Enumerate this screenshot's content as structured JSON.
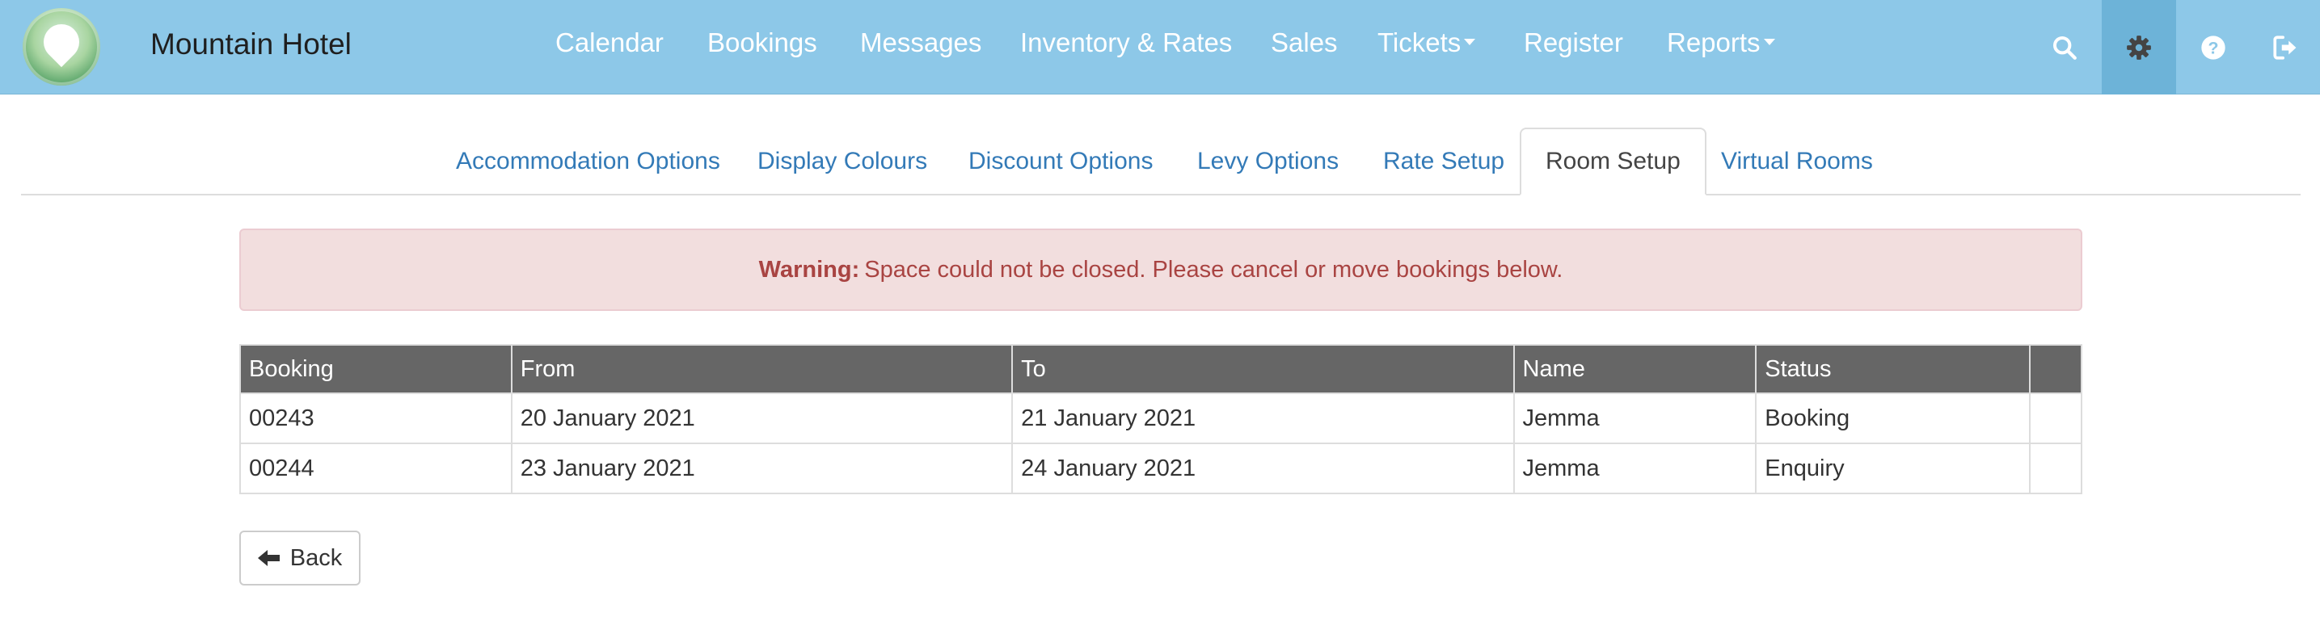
{
  "app": {
    "brand": "Mountain Hotel"
  },
  "nav": {
    "items": [
      {
        "label": "Calendar"
      },
      {
        "label": "Bookings"
      },
      {
        "label": "Messages"
      },
      {
        "label": "Inventory & Rates"
      },
      {
        "label": "Sales"
      },
      {
        "label": "Tickets",
        "dropdown": true
      },
      {
        "label": "Register"
      },
      {
        "label": "Reports",
        "dropdown": true
      }
    ],
    "icons": [
      "search-icon",
      "gear-icon",
      "help-icon",
      "logout-icon"
    ],
    "active_icon": "gear-icon"
  },
  "tabs": {
    "items": [
      {
        "label": "Accommodation Options"
      },
      {
        "label": "Display Colours"
      },
      {
        "label": "Discount Options"
      },
      {
        "label": "Levy Options"
      },
      {
        "label": "Rate Setup"
      },
      {
        "label": "Room Setup"
      },
      {
        "label": "Virtual Rooms"
      }
    ],
    "active": "Room Setup"
  },
  "alert": {
    "strong": "Warning:",
    "message": "Space could not be closed. Please cancel or move bookings below."
  },
  "table": {
    "headers": [
      "Booking",
      "From",
      "To",
      "Name",
      "Status",
      ""
    ],
    "rows": [
      {
        "booking": "00243",
        "from": "20 January 2021",
        "to": "21 January 2021",
        "name": "Jemma",
        "status": "Booking"
      },
      {
        "booking": "00244",
        "from": "23 January 2021",
        "to": "24 January 2021",
        "name": "Jemma",
        "status": "Enquiry"
      }
    ]
  },
  "actions": {
    "back_label": "Back"
  },
  "colors": {
    "navbar": "#8dc8e8",
    "link": "#337ab7",
    "alert_text": "#a94442",
    "alert_bg": "#f2dede",
    "table_header": "#666666"
  }
}
